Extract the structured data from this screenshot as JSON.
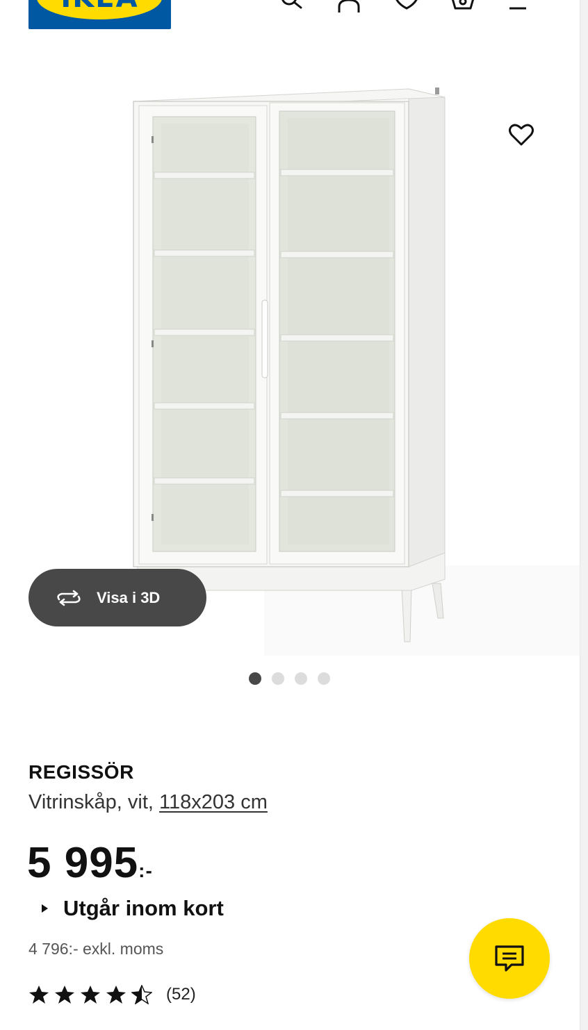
{
  "header": {
    "logo_text": "IKEA",
    "icons": [
      "search-icon",
      "profile-icon",
      "heart-icon",
      "cart-icon",
      "menu-icon"
    ]
  },
  "gallery": {
    "view3d_label": "Visa i 3D",
    "slides": 4,
    "active_slide": 1
  },
  "product": {
    "name": "REGISSÖR",
    "description_prefix": "Vitrinskåp, vit, ",
    "size_link": "118x203 cm",
    "price_main": "5 995",
    "price_suffix": ":-",
    "availability": "Utgår inom kort",
    "price_excl_vat": "4 796:- exkl. moms",
    "rating_value": 4.5,
    "rating_count": "(52)"
  },
  "colors": {
    "ikea_blue": "#0058a3",
    "ikea_yellow": "#ffdb00",
    "dark_button": "#484848"
  }
}
